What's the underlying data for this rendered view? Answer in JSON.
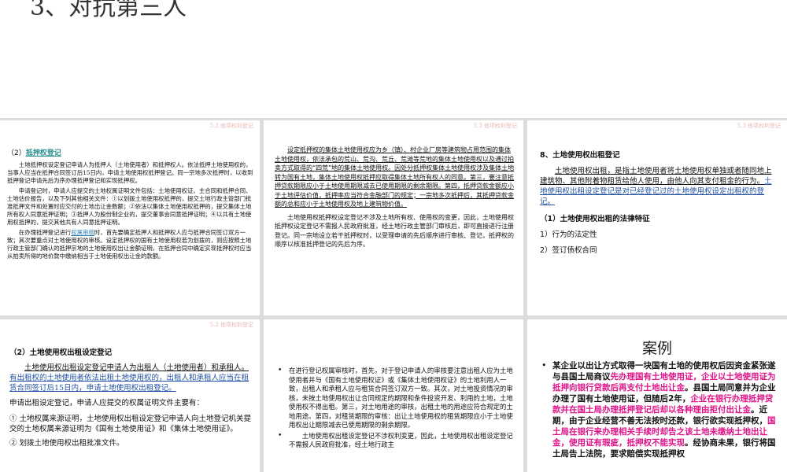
{
  "top_slide": {
    "title": "3、对抗第三人"
  },
  "slide_header": "5.3 他项权利登记",
  "s1": {
    "heading_num": "（2）",
    "heading_link": "抵押权登记",
    "p1": "土地抵押权设定登记申请人为抵押人（土地使用者）和抵押权人。依法抵押土地使用权的，当事人应当在抵押合同签订后15日内，申请土地使用权抵押登记。同一宗地多次抵押时，以收到抵押登记申请先后为序办理抵押登记和实现抵押权。",
    "p2": "申请登记时，申请人应提交的土地权属证明文件包括：土地使用权证、主合同和抵押合同、土地估价报告，以及下列其他相关文件：①以划拨土地使用权抵押的，提交土地行政主管部门批准抵押文件和处置时应交付的土地出让金数额；②依法以集体土地使用权抵押的，提交集体土地所有权人同意抵押证明；③抵押人为股份制企业的，提交董事会同意抵押证明；④以共有土地使用权抵押的，提交其他共有人同意抵押证明。",
    "p3a": "在办理抵押登记进行",
    "p3link": "权属审核",
    "p3b": "时，首先要确定抵押人和抵押权人应与抵押合同签订双方一致；其次要重点对土地使用权的审核。设定抵押权的国有土地使用权若为划拨的，则应按照土地行政主管部门确认的抵押宗地的土地使用权出让金额证明，在抵押合同中确定实现抵押权时应当从拍卖所得的地价款中缴纳相当于土地使用权出让金的款额。"
  },
  "s2": {
    "p1": "设定抵押权的集体土地使用权应为乡（镇）、村企业厂房等建筑物占用范围的集体土地使用权，依法承包的荒山、荒沟、荒丘、荒滩等荒地的集体土地使用权以及通过拍卖方式取得的“四荒”地的集体土地使用权。因处分抵押权集体土地使用权涉及集体土地转为国有土地，集体土地使用权抵押应取得集体土地所有权人的同意。第三，要注意抵押贷款期限应小于土地使用期限减去已使用期限的剩余期限。第四，抵押贷款金额应小于土地评估价值，抵押率应当符合金融部门的规定；一宗地多次抵押后，其抵押贷款金额的总和应小于土地使用权及地上建筑物价值。",
    "p2": "土地使用权抵押权设定登记不涉及土地所有权、使用权的变更，因此，土地使用权抵押权设定登记不需报人民政府批准，经土地行政主管部门审核后，即可直接进行注册登记。同一宗地设立若干抵押权时，以受理申请的先后顺序进行审核、登记，抵押权的顺序以核准抵押登记的先后为序。"
  },
  "s3": {
    "heading": "8、土地使用权出租登记",
    "p1": "土地使用权出租，是指土地使用者将土地使用权单独或者随同地上建筑物、其他附着物租赁给他人使用，由他人向其支付租金的行为。",
    "p1b": "土地使用权出租设定登记是对已经登记过的土地使用权设定出租权的登记。",
    "sub": "（1）土地使用权出租的法律特征",
    "i1": "1）行为的法定性",
    "i2": "2）签订债权合同"
  },
  "s4": {
    "heading": "（2）土地使用权出租设定登记",
    "p1a": "土地使用权出租设定登记申请人为出租人（土地使用者）和承租人。",
    "p1b": "有出租权的土地使用者依法出租土地使用权的，出租人和承租人应当在租赁合同签订后15日内，申请土地使用权出租登记。",
    "p2": "申请出租设定登记，申请人应提交的权属证明文件主要有：",
    "l1": "① 土地权属来源证明，土地使用权出租设定登记申请人向土地登记机关提交的土地权属来源证明为《国有土地使用证》和《集体土地使用证》。",
    "l2": "② 划拨土地使用权出租批准文件。"
  },
  "s5": {
    "b1": "在进行登记权属审核时，首先，对于登记申请人的审核要注意出租人应为土地使用者并与《国有土地使用权证》或《集体土地使用权证》的土地利用人一致，出租人和承租人应与租赁合同签订双方一致。其次，对土地投资情况的审核，未按土地使用权出让合同规定的期限和条件投资开发、利用的土地，土地使用权不得出租。第三，对土地用途的审核，出租土地的用途应符合规定的土地用途。第四，对租赁期限的审核：出让土地使用权的租赁期限应小于土地使用权出让期限减去已使用期限的剩余期限。",
    "b2": "土地使用权出租设定登记不涉权利变更，因此，土地使用权出租设定登记不需报人民政府批准，经土地行政主"
  },
  "s6": {
    "title": "案例",
    "t1": "某企业以出让方式取得一块国有土地的使用权后因资金紧张遂与县国土局商议",
    "m1": "先办理国有土地使用证，企业以土地使用证为抵押向银行贷款后再支付土地出让金",
    "t2": "。县国土局同意并为企业办理了国有土地使用证，但随后2年，",
    "m2": "企业在银行办理抵押贷款并在国土局办理抵押登记后却以各种理由拒付出让金",
    "t3": "。近期，由于企业经营不善无法按时还款，银行欲实现抵押权，",
    "m3": "国土局在银行来办理相关手续时却告之该土地未缴纳土地出让金，使用证有瑕疵，抵押权不能实现",
    "t4": "。经协商未果，银行将国土局告上法院，要求赔偿实现抵押权"
  }
}
